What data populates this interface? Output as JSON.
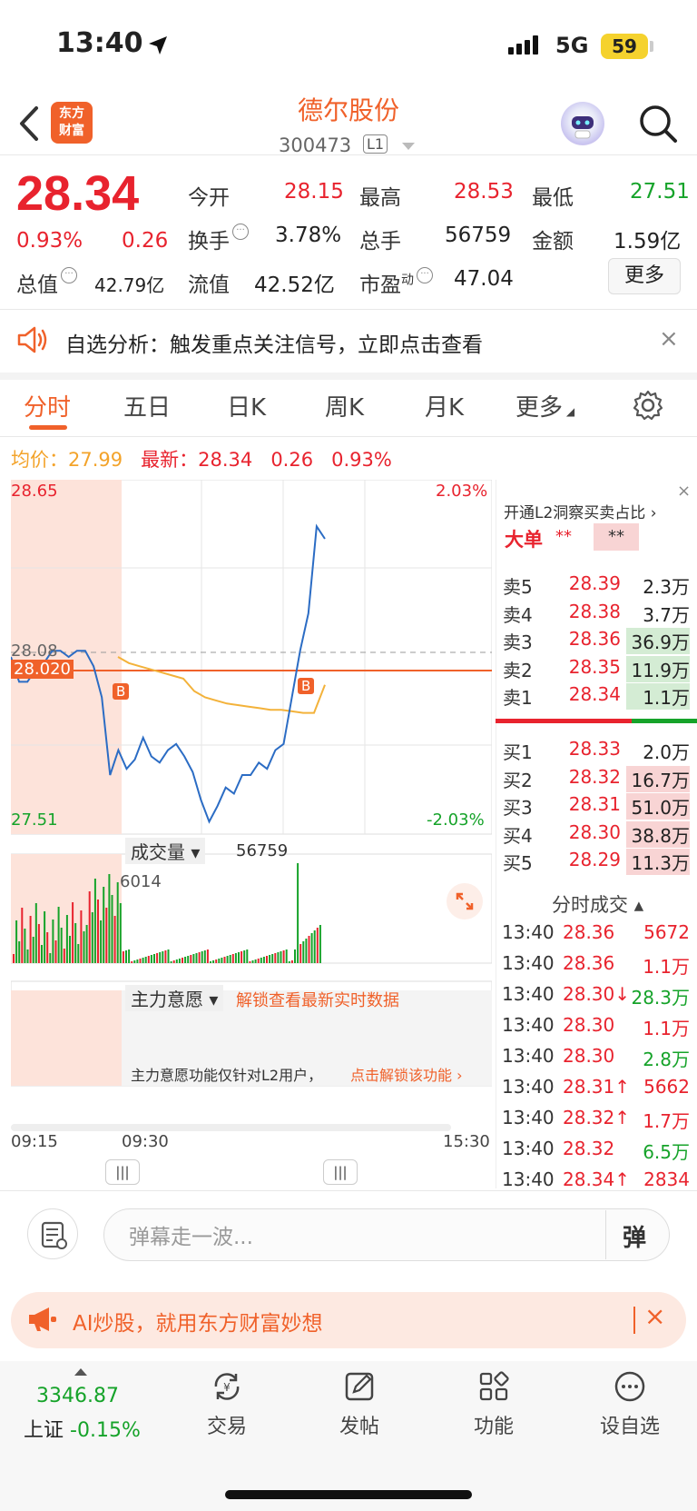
{
  "status": {
    "time": "13:40",
    "network": "5G",
    "battery": "59"
  },
  "header": {
    "logo_line1": "东方",
    "logo_line2": "财富",
    "name": "德尔股份",
    "code": "300473",
    "level": "L1"
  },
  "quote": {
    "price": "28.34",
    "pct": "0.93%",
    "chg": "0.26",
    "open_label": "今开",
    "open": "28.15",
    "high_label": "最高",
    "high": "28.53",
    "low_label": "最低",
    "low": "27.51",
    "turnover_label": "换手",
    "turnover": "3.78%",
    "volume_label": "总手",
    "volume": "56759",
    "amount_label": "金额",
    "amount": "1.59亿",
    "mcap_label": "总值",
    "mcap": "42.79亿",
    "float_label": "流值",
    "float": "42.52亿",
    "pe_label": "市盈",
    "pe_sup": "动",
    "pe": "47.04",
    "more": "更多"
  },
  "notice": {
    "text": "自选分析：触发重点关注信号，立即点击查看",
    "close": "×"
  },
  "tabs": [
    "分时",
    "五日",
    "日K",
    "周K",
    "月K",
    "更多"
  ],
  "chart_info": {
    "avg_label": "均价：",
    "avg": "27.99",
    "latest_label": "最新：",
    "latest": "28.34",
    "chg": "0.26",
    "pct": "0.93%"
  },
  "chart_data": {
    "type": "line",
    "y_labels": {
      "top": "28.65",
      "bottom": "27.51",
      "top_pct": "2.03%",
      "bottom_pct": "-2.03%",
      "ref": "28.08",
      "cursor": "28.020"
    },
    "ylim": [
      27.51,
      28.65
    ],
    "x_labels": [
      "09:15",
      "09:30",
      "15:30"
    ],
    "markers": [
      "B",
      "B"
    ],
    "volume_label": "成交量",
    "volume_total": "56759",
    "volume_peak": "6014",
    "flow_label": "主力意愿",
    "flow_unlock": "解锁查看最新实时数据",
    "flow_msg": "主力意愿功能仅针对L2用户，",
    "flow_link": "点击解锁该功能",
    "price_series": [
      28.08,
      28.0,
      28.0,
      28.04,
      28.06,
      28.1,
      28.1,
      28.08,
      28.1,
      28.1,
      28.05,
      27.95,
      27.7,
      27.78,
      27.72,
      27.75,
      27.82,
      27.76,
      27.74,
      27.78,
      27.8,
      27.76,
      27.71,
      27.62,
      27.55,
      27.6,
      27.66,
      27.64,
      27.7,
      27.7,
      27.74,
      27.72,
      27.78,
      27.8,
      27.95,
      28.1,
      28.22,
      28.5,
      28.46
    ],
    "avg_series": [
      28.08,
      28.06,
      28.05,
      28.04,
      28.03,
      28.02,
      28.01,
      27.97,
      27.95,
      27.94,
      27.93,
      27.925,
      27.92,
      27.915,
      27.91,
      27.91,
      27.905,
      27.9,
      27.9,
      27.99
    ]
  },
  "orderbook": {
    "l2_link": "开通L2洞察买卖占比",
    "big_label": "大单",
    "big_a": "**",
    "big_b": "**",
    "asks": [
      {
        "label": "卖5",
        "price": "28.39",
        "vol": "2.3万"
      },
      {
        "label": "卖4",
        "price": "28.38",
        "vol": "3.7万"
      },
      {
        "label": "卖3",
        "price": "28.36",
        "vol": "36.9万"
      },
      {
        "label": "卖2",
        "price": "28.35",
        "vol": "11.9万"
      },
      {
        "label": "卖1",
        "price": "28.34",
        "vol": "1.1万"
      }
    ],
    "bids": [
      {
        "label": "买1",
        "price": "28.33",
        "vol": "2.0万"
      },
      {
        "label": "买2",
        "price": "28.32",
        "vol": "16.7万"
      },
      {
        "label": "买3",
        "price": "28.31",
        "vol": "51.0万"
      },
      {
        "label": "买4",
        "price": "28.30",
        "vol": "38.8万"
      },
      {
        "label": "买5",
        "price": "28.29",
        "vol": "11.3万"
      }
    ],
    "ticks_label": "分时成交",
    "ticks": [
      {
        "time": "13:40",
        "price": "28.36",
        "vol": "5672",
        "c": "red"
      },
      {
        "time": "13:40",
        "price": "28.36",
        "vol": "1.1万",
        "c": "red"
      },
      {
        "time": "13:40",
        "price": "28.30↓",
        "vol": "28.3万",
        "c": "green"
      },
      {
        "time": "13:40",
        "price": "28.30",
        "vol": "1.1万",
        "c": "red"
      },
      {
        "time": "13:40",
        "price": "28.30",
        "vol": "2.8万",
        "c": "green"
      },
      {
        "time": "13:40",
        "price": "28.31↑",
        "vol": "5662",
        "c": "red"
      },
      {
        "time": "13:40",
        "price": "28.32↑",
        "vol": "1.7万",
        "c": "red"
      },
      {
        "time": "13:40",
        "price": "28.32",
        "vol": "6.5万",
        "c": "green"
      },
      {
        "time": "13:40",
        "price": "28.34↑",
        "vol": "2834",
        "c": "red"
      }
    ]
  },
  "danmu": {
    "placeholder": "弹幕走一波...",
    "send": "弹"
  },
  "ai_banner": {
    "text": "AI炒股，就用东方财富妙想",
    "close": "×"
  },
  "bottom_nav": {
    "index_value": "3346.87",
    "index_name": "上证",
    "index_pct": "-0.15%",
    "items": [
      "交易",
      "发帖",
      "功能",
      "设自选"
    ]
  }
}
